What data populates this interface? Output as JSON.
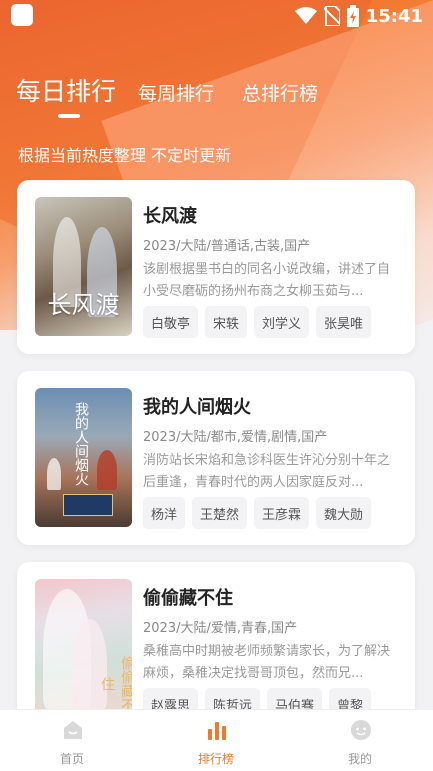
{
  "status_bar": {
    "time": "15:41"
  },
  "tabs": [
    {
      "label": "每日排行",
      "active": true
    },
    {
      "label": "每周排行",
      "active": false
    },
    {
      "label": "总排行榜",
      "active": false
    }
  ],
  "subtitle": "根据当前热度整理 不定时更新",
  "cards": [
    {
      "title": "长风渡",
      "meta": "2023/大陆/普通话,古装,国产",
      "desc": "该剧根据墨书白的同名小说改编，讲述了自小受尽磨砺的扬州布商之女柳玉茹与...",
      "poster_text": "长风渡",
      "cast": [
        "白敬亭",
        "宋轶",
        "刘学义",
        "张昊唯"
      ]
    },
    {
      "title": "我的人间烟火",
      "meta": "2023/大陆/都市,爱情,剧情,国产",
      "desc": "消防站长宋焰和急诊科医生许沁分别十年之后重逢，青春时代的两人因家庭反对...",
      "poster_text": "我的人间烟火",
      "cast": [
        "杨洋",
        "王楚然",
        "王彦霖",
        "魏大勋"
      ]
    },
    {
      "title": "偷偷藏不住",
      "meta": "2023/大陆/爱情,青春,国产",
      "desc": "桑稚高中时期被老师频繁请家长，为了解决麻烦，桑稚决定找哥哥顶包，然而兄...",
      "poster_text": "偷偷藏不住",
      "cast": [
        "赵露思",
        "陈哲远",
        "马伯骞",
        "曾黎"
      ]
    }
  ],
  "bottom_nav": [
    {
      "label": "首页",
      "icon": "home-icon",
      "active": false
    },
    {
      "label": "排行榜",
      "icon": "bar-chart-icon",
      "active": true
    },
    {
      "label": "我的",
      "icon": "profile-icon",
      "active": false
    }
  ],
  "colors": {
    "accent": "#f07a2a",
    "hero_orange": "#f06a2a"
  }
}
